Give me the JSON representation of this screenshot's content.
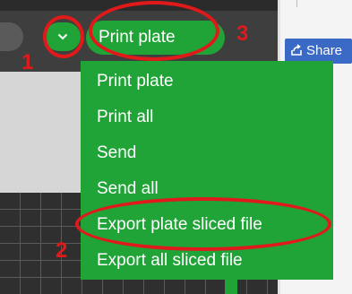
{
  "toolbar": {
    "print_button_label": "Print plate",
    "share_button_label": "Share"
  },
  "menu": {
    "items": [
      {
        "label": "Print plate"
      },
      {
        "label": "Print all"
      },
      {
        "label": "Send"
      },
      {
        "label": "Send all"
      },
      {
        "label": "Export plate sliced file"
      },
      {
        "label": "Export all sliced file"
      }
    ]
  },
  "annotations": {
    "numbers": [
      "1",
      "2",
      "3"
    ],
    "color": "#e01a1a"
  },
  "colors": {
    "accent_green": "#21a437",
    "share_blue": "#3b69c6",
    "annotation_red": "#e01a1a"
  }
}
